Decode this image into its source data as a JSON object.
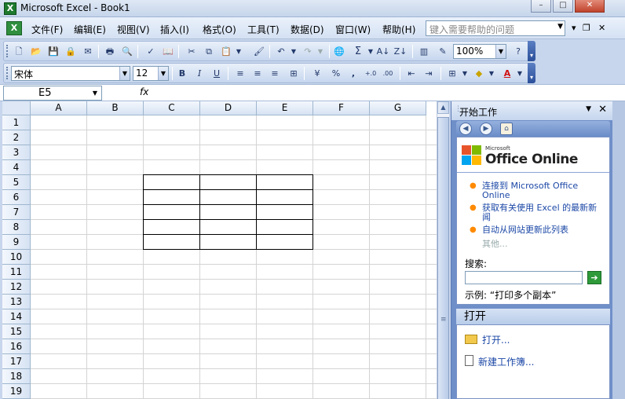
{
  "window": {
    "title": "Microsoft Excel - Book1",
    "minimize": "–",
    "maximize": "□",
    "close": "✕"
  },
  "menu": {
    "items": [
      "文件(F)",
      "编辑(E)",
      "视图(V)",
      "插入(I)",
      "格式(O)",
      "工具(T)",
      "数据(D)",
      "窗口(W)",
      "帮助(H)"
    ],
    "help_placeholder": "键入需要帮助的问题"
  },
  "toolbar_standard": {
    "zoom": "100%"
  },
  "toolbar_format": {
    "font": "宋体",
    "size": "12",
    "bold": "B",
    "italic": "I",
    "underline": "U",
    "percent": "%",
    "comma": ","
  },
  "formula_bar": {
    "name_box": "E5",
    "fx": "fx",
    "value": ""
  },
  "sheet": {
    "columns": [
      "A",
      "B",
      "C",
      "D",
      "E",
      "F",
      "G"
    ],
    "rows": [
      "1",
      "2",
      "3",
      "4",
      "5",
      "6",
      "7",
      "8",
      "9",
      "10",
      "11",
      "12",
      "13",
      "14",
      "15",
      "16",
      "17",
      "18",
      "19"
    ],
    "bordered_range": "C5:E9",
    "active_cell": "E5"
  },
  "task_pane": {
    "title": "开始工作",
    "logo_small": "Microsoft",
    "logo": "Office Online",
    "links": [
      "连接到 Microsoft Office Online",
      "获取有关使用 Excel 的最新新闻",
      "自动从网站更新此列表"
    ],
    "more": "其他...",
    "search_label": "搜索:",
    "search_value": "",
    "example": "示例:  “打印多个副本”",
    "open_header": "打开",
    "open_items": [
      "打开...",
      "新建工作簿..."
    ]
  }
}
